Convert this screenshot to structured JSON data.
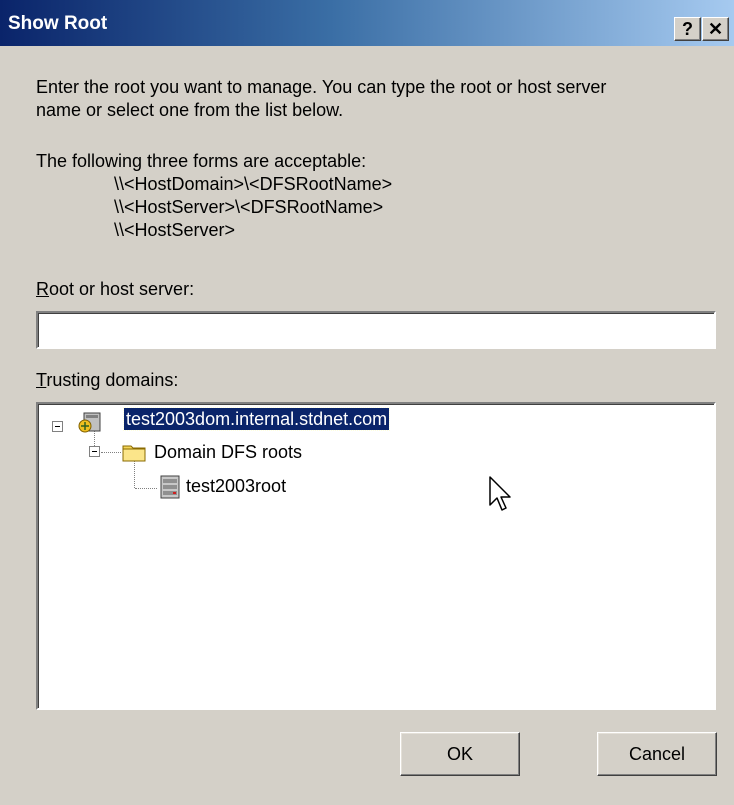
{
  "window": {
    "title": "Show Root",
    "help_label": "?",
    "close_label": "✕"
  },
  "intro": {
    "line1": "Enter the root you want to manage. You can type the root or host server",
    "line2": "name or select one from the list below.",
    "forms_heading": "The following three forms are acceptable:",
    "form1": "\\\\<HostDomain>\\<DFSRootName>",
    "form2": "\\\\<HostServer>\\<DFSRootName>",
    "form3": "\\\\<HostServer>"
  },
  "root_field": {
    "label_mnemonic": "R",
    "label_rest": "oot or host server:",
    "value": ""
  },
  "trusting": {
    "label_mnemonic": "T",
    "label_rest": "rusting domains:"
  },
  "tree": {
    "domain": "test2003dom.internal.stdnet.com",
    "group": "Domain DFS roots",
    "root": "test2003root"
  },
  "buttons": {
    "ok": "OK",
    "cancel": "Cancel"
  },
  "icons": [
    "help-icon",
    "close-icon",
    "domain-icon",
    "folder-icon",
    "server-icon",
    "mouse-cursor-icon"
  ]
}
